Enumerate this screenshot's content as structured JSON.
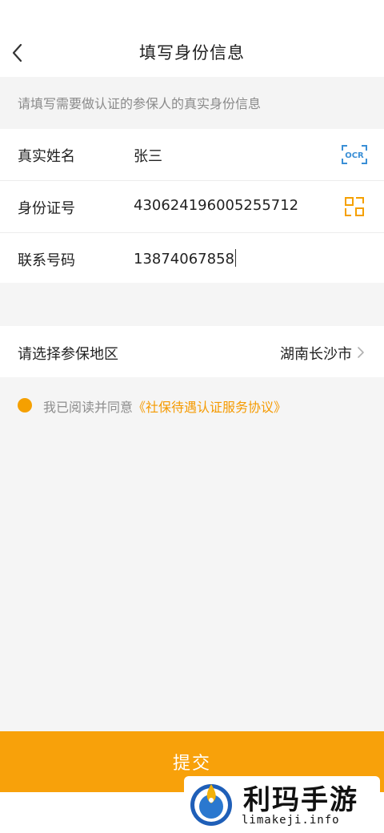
{
  "header": {
    "title": "填写身份信息",
    "back_icon": "chevron-left-icon"
  },
  "hint": "请填写需要做认证的参保人的真实身份信息",
  "form": {
    "name": {
      "label": "真实姓名",
      "value": "张三",
      "icon": "ocr-scan-icon",
      "icon_text": "OCR"
    },
    "id_number": {
      "label": "身份证号",
      "value": "430624196005255712",
      "icon": "scan-frame-icon"
    },
    "phone": {
      "label": "联系号码",
      "value": "13874067858"
    }
  },
  "region": {
    "label": "请选择参保地区",
    "value": "湖南长沙市",
    "icon": "chevron-right-icon"
  },
  "agreement": {
    "prefix": "我已阅读并同意",
    "link": "《社保待遇认证服务协议》"
  },
  "submit": {
    "label": "提交"
  },
  "watermark": {
    "title": "利玛手游",
    "subtitle": "limakeji.info"
  },
  "colors": {
    "accent": "#f8a10a",
    "link": "#f59a00",
    "ocr_blue": "#3a8fd6",
    "hint_gray": "#8a8a8a"
  }
}
